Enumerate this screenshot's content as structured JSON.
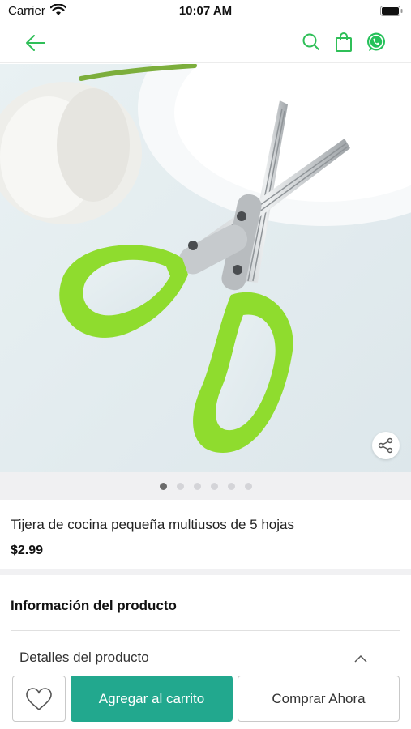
{
  "status_bar": {
    "carrier": "Carrier",
    "time": "10:07 AM"
  },
  "nav": {
    "icons": [
      "back-arrow-icon",
      "search-icon",
      "shopping-bag-icon",
      "whatsapp-icon"
    ]
  },
  "colors": {
    "accent": "#22a88e",
    "icon_green": "#2fbf58",
    "whatsapp": "#25c15a"
  },
  "carousel": {
    "image_count": 6,
    "active_index": 0
  },
  "product": {
    "title": "Tijera de cocina pequeña multiusos de 5 hojas",
    "price": "$2.99"
  },
  "info": {
    "heading": "Información del producto",
    "details_label": "Detalles del producto"
  },
  "actions": {
    "add_to_cart": "Agregar al carrito",
    "buy_now": "Comprar Ahora"
  }
}
